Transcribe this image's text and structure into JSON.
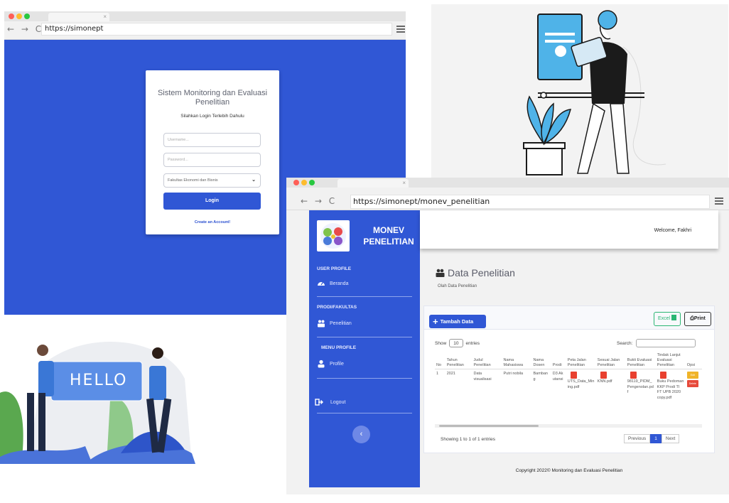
{
  "login_window": {
    "url": "https://simonept",
    "card": {
      "title": "Sistem Monitoring dan Evaluasi Penelitian",
      "subtitle": "Silahkan Login Terlebih Dahulu",
      "username_placeholder": "Username...",
      "password_placeholder": "Password...",
      "faculty_selected": "Fakultas Ekonomi dan Bisnis",
      "login_label": "Login",
      "create_account_label": "Create an Account!"
    },
    "colors": {
      "brand": "#3057d5"
    }
  },
  "hello_illustration": {
    "sign_text": "HELLO"
  },
  "dashboard_window": {
    "url": "https://simonept/monev_penelitian",
    "sidebar": {
      "brand": "MONEV PENELITIAN",
      "sections": [
        {
          "heading": "USER PROFILE",
          "item": "Beranda",
          "icon": "tachometer-icon"
        },
        {
          "heading": "PRODI/FAKULTAS",
          "item": "Penelitian",
          "icon": "users-icon"
        },
        {
          "heading": "MENU PROFILE",
          "item": "Profile",
          "icon": "user-icon"
        }
      ],
      "logout_label": "Logout",
      "collapse_glyph": "‹"
    },
    "topbar": {
      "welcome": "Welcome, Fakhri"
    },
    "page": {
      "title": "Data Penelitian",
      "subtitle": "Olah Data Penelitian"
    },
    "toolbar": {
      "add_label": "Tambah Data",
      "excel_label": "Excel",
      "print_label": "Print"
    },
    "table_controls": {
      "show_label": "Show",
      "entries_value": "10",
      "entries_label": "entries",
      "search_label": "Search:"
    },
    "table": {
      "headers": [
        "No",
        "Tahun Penelitian",
        "Judul Penelitian",
        "Nama Mahasiswa",
        "Nama Dosen",
        "Prodi",
        "Peta Jalan Penelitian",
        "Sesuai Jalan Penelitian",
        "Bukti Evaluasi Penelitian",
        "Tindak Lanjut Evaluasi Penelitian",
        "Opsi"
      ],
      "rows": [
        {
          "no": "1",
          "tahun": "2021",
          "judul": "Data visualisasi",
          "mahasiswa": "Putri nobila",
          "dosen": "Bambang",
          "prodi": "D3 Akutansi",
          "peta": "UTS_Data_Mining.pdf",
          "sesuai": "KNN.pdf",
          "bukti": "98119_PIDM_Pengenolan.pdf",
          "tindak": "Buku Pedoman KKP Prodi TI FT UPB 2020 copy.pdf",
          "opsi": [
            "Edit",
            "Delete"
          ]
        }
      ]
    },
    "pagination": {
      "info": "Showing 1 to 1 of 1 entries",
      "previous": "Previous",
      "current": "1",
      "next": "Next"
    },
    "footer": "Copyright 2022© Monitoring dan Evaluasi Penelitian"
  }
}
